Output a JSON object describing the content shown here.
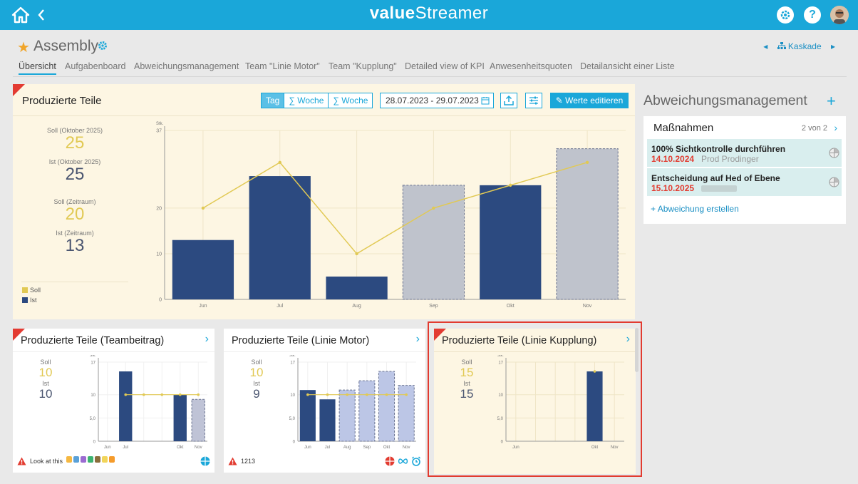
{
  "app": {
    "logo_text": "value",
    "logo_text2": "Streamer"
  },
  "page": {
    "title": "Assembly",
    "kaskade": "Kaskade"
  },
  "tabs": [
    "Übersicht",
    "Aufgabenboard",
    "Abweichungsmanagement",
    "Team \"Linie Motor\"",
    "Team \"Kupplung\"",
    "Detailed view of KPI",
    "Anwesenheitsquoten",
    "Detailansicht einer Liste"
  ],
  "main_card": {
    "title": "Produzierte Teile",
    "toggle": [
      "Tag",
      "∑ Woche",
      "∑ Woche"
    ],
    "date_range": "28.07.2023 - 29.07.2023",
    "edit_label": "Werte editieren",
    "stats": [
      {
        "label": "Soll (Oktober 2025)",
        "value": "25",
        "kind": "soll"
      },
      {
        "label": "Ist (Oktober 2025)",
        "value": "25",
        "kind": "ist"
      },
      {
        "label": "Soll (Zeitraum)",
        "value": "20",
        "kind": "soll"
      },
      {
        "label": "Ist (Zeitraum)",
        "value": "13",
        "kind": "ist"
      }
    ],
    "legend": [
      "Soll",
      "Ist"
    ]
  },
  "small_cards": [
    {
      "title": "Produzierte Teile (Teambeitrag)",
      "soll_label": "Soll",
      "soll": "10",
      "ist_label": "Ist",
      "ist": "10",
      "footer_text": "Look at this"
    },
    {
      "title": "Produzierte Teile (Linie Motor)",
      "soll_label": "Soll",
      "soll": "10",
      "ist_label": "Ist",
      "ist": "9",
      "footer_text": "1213"
    },
    {
      "title": "Produzierte Teile (Linie Kupplung)",
      "soll_label": "Soll",
      "soll": "15",
      "ist_label": "Ist",
      "ist": "15"
    }
  ],
  "right_panel": {
    "title": "Abweichungsmanagement",
    "card_title": "Maßnahmen",
    "pagination": "2 von 2",
    "items": [
      {
        "title": "100% Sichtkontrolle durchführen",
        "date": "14.10.2024",
        "owner": "Prod Prodinger"
      },
      {
        "title": "Entscheidung auf Hed of Ebene",
        "date": "15.10.2025",
        "owner": ""
      }
    ],
    "create_label": "Abweichung erstellen"
  },
  "colors": {
    "accent": "#1aa7d9",
    "ist": "#2c4a80",
    "forecast": "#bfc3cc",
    "soll": "#e1c954",
    "warn": "#e23b30"
  },
  "chart_data": [
    {
      "type": "bar",
      "title": "Produzierte Teile",
      "ylabel": "Stk.",
      "ylim": [
        0,
        37
      ],
      "yticks": [
        "0",
        "10",
        "20",
        "37"
      ],
      "categories": [
        "Jun",
        "Jul",
        "Aug",
        "Sep",
        "Okt",
        "Nov"
      ],
      "series": [
        {
          "name": "Ist",
          "values": [
            13,
            27,
            5,
            25,
            25,
            33
          ],
          "forecast": [
            false,
            false,
            false,
            true,
            false,
            true
          ]
        },
        {
          "name": "Soll",
          "type": "line",
          "values": [
            20,
            30,
            10,
            20,
            25,
            30
          ]
        }
      ]
    },
    {
      "type": "bar",
      "ylabel": "Stk.",
      "ylim": [
        0,
        17
      ],
      "yticks": [
        "0",
        "5,0",
        "10",
        "17"
      ],
      "categories": [
        "Jun",
        "Jul",
        "Aug",
        "Sep",
        "Okt",
        "Nov"
      ],
      "xticks": [
        "Jun",
        "Jul",
        "Okt",
        "Nov"
      ],
      "series": [
        {
          "name": "Ist",
          "values": [
            0,
            15,
            0,
            0,
            10,
            9
          ],
          "forecast": [
            false,
            false,
            false,
            false,
            false,
            true
          ]
        },
        {
          "name": "Soll",
          "type": "line",
          "values": [
            null,
            10,
            10,
            10,
            10,
            10
          ]
        }
      ]
    },
    {
      "type": "bar",
      "ylabel": "Stk.",
      "ylim": [
        0,
        17
      ],
      "yticks": [
        "0",
        "5,0",
        "10",
        "17"
      ],
      "categories": [
        "Jun",
        "Jul",
        "Aug",
        "Sep",
        "Okt",
        "Nov"
      ],
      "xticks": [
        "Jun",
        "Jul",
        "Aug",
        "Sep",
        "Okt",
        "Nov"
      ],
      "series": [
        {
          "name": "Ist",
          "values": [
            11,
            9,
            11,
            13,
            15,
            12
          ],
          "forecast": [
            false,
            false,
            true,
            true,
            true,
            true
          ]
        },
        {
          "name": "Soll",
          "type": "line",
          "values": [
            10,
            10,
            10,
            10,
            10,
            10
          ]
        }
      ]
    },
    {
      "type": "bar",
      "ylabel": "Stk.",
      "ylim": [
        0,
        17
      ],
      "yticks": [
        "0",
        "5,0",
        "10",
        "17"
      ],
      "categories": [
        "Jun",
        "Jul",
        "Aug",
        "Sep",
        "Okt",
        "Nov"
      ],
      "xticks": [
        "Jun",
        "Okt",
        "Nov"
      ],
      "series": [
        {
          "name": "Ist",
          "values": [
            0,
            0,
            0,
            0,
            15,
            0
          ],
          "forecast": [
            false,
            false,
            false,
            false,
            false,
            false
          ]
        },
        {
          "name": "Soll",
          "type": "line",
          "values": [
            null,
            null,
            null,
            null,
            15,
            null
          ]
        }
      ]
    }
  ]
}
